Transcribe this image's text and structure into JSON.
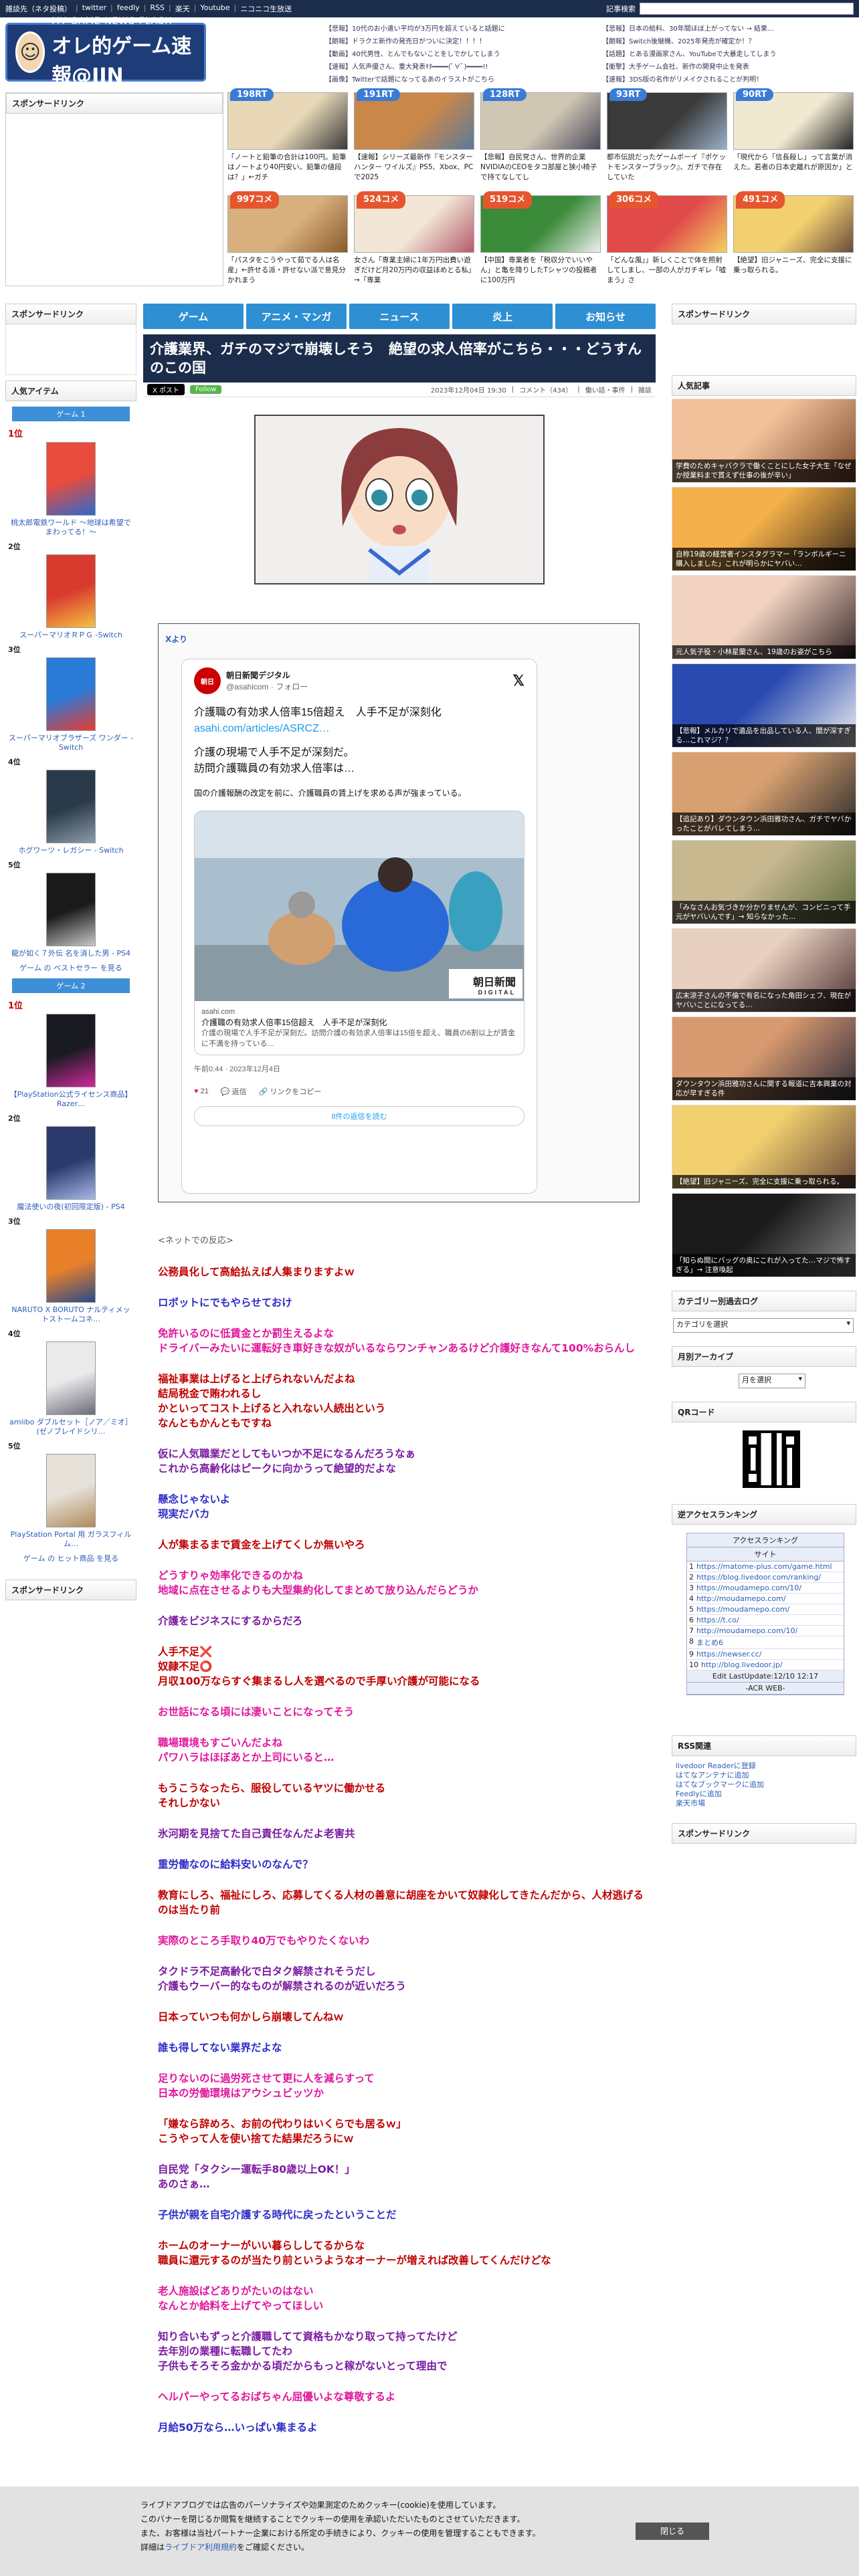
{
  "topbar": {
    "links": [
      "雑談先（ネタ投稿）",
      "twitter",
      "feedly",
      "RSS",
      "楽天",
      "Youtube",
      "ニコニコ生放送"
    ],
    "search_label": "記事検索",
    "search_placeholder": ""
  },
  "logo": {
    "sub": "MY GAME NEWS FLASH",
    "main": "オレ的ゲーム速報@JIN"
  },
  "head_links_left": [
    "【悲報】10代のお小遣い平均が3万円を超えていると話題に",
    "【朗報】ドラクエ新作の発売日がついに決定！！！！",
    "【動画】40代男性、とんでもないことをしでかしてしまう",
    "【速報】人気声優さん、重大発表ｷﾀ━━━━(ﾟ∀ﾟ)━━━━!!",
    "【画像】Twitterで話題になってるあのイラストがこちら"
  ],
  "head_links_right": [
    "【悲報】日本の給料、30年間ほぼ上がってない → 結果…",
    "【朗報】Switch後継機、2025年発売が確定か！？",
    "【話題】とある漫画家さん、YouTubeで大暴走してしまう",
    "【衝撃】大手ゲーム会社、新作の開発中止を発表",
    "【速報】3DS版の名作がリメイクされることが判明！"
  ],
  "sponsor_label": "スポンサードリンク",
  "thumbs": [
    {
      "badge": "198RT",
      "kind": "rt",
      "cap": "「ノートと鉛筆の合計は100円。鉛筆はノートより40円安い。鉛筆の値段は？」←ガチ",
      "c1": "#e8d8b8",
      "c2": "#3a3a3a"
    },
    {
      "badge": "191RT",
      "kind": "rt",
      "cap": "【速報】シリーズ最新作『モンスターハンター ワイルズ』PS5、Xbox、PCで2025",
      "c1": "#c9874a",
      "c2": "#5a7a9a"
    },
    {
      "badge": "128RT",
      "kind": "rt",
      "cap": "【悲報】自民党さん、世界的企業NVIDIAのCEOをタコ部屋と狭小椅子で持てなしてし",
      "c1": "#d0c6b4",
      "c2": "#4a4a5a"
    },
    {
      "badge": "93RT",
      "kind": "rt",
      "cap": "都市伝説だったゲームボーイ『ポケットモンスタープラック』、ガチで存在していた",
      "c1": "#3a3a3a",
      "c2": "#9ab0c8"
    },
    {
      "badge": "90RT",
      "kind": "rt",
      "cap": "「現代から「信長殺し」って言葉が消えた。若者の日本史離れが原因か」と",
      "c1": "#f0e8d0",
      "c2": "#222222"
    },
    {
      "badge": "997コメ",
      "kind": "cm",
      "cap": "「パスタをこうやって茹でる人は名産」←許せる派・許せない派で意見分かれまう",
      "c1": "#d8b080",
      "c2": "#8a5a2a"
    },
    {
      "badge": "524コメ",
      "kind": "cm",
      "cap": "女さん「専業主婦に1年万円出費い遊ぎだけど月20万円の収益ほめとる私」→「専業",
      "c1": "#f2e6d6",
      "c2": "#b45a6a"
    },
    {
      "badge": "519コメ",
      "kind": "cm",
      "cap": "【中国】専業者を「税収分でいいやん」と亀を降りしたTシャツの投稿者に100万円",
      "c1": "#3a8a3a",
      "c2": "#eeeeee"
    },
    {
      "badge": "306コメ",
      "kind": "cm",
      "cap": "「どんな風」」新しくことで体を照射してしまし、一部の人がガチギレ「嘘まう」さ",
      "c1": "#e04a4a",
      "c2": "#f4d060"
    },
    {
      "badge": "491コメ",
      "kind": "cm",
      "cap": "【絶望】旧ジャニーズ、完全に支援に乗っ取られる。",
      "c1": "#f2d070",
      "c2": "#6a4a3a"
    }
  ],
  "nav": [
    "ゲーム",
    "アニメ・マンガ",
    "ニュース",
    "炎上",
    "お知らせ"
  ],
  "left_sidebar": {
    "sponsor": "スポンサードリンク",
    "popular": "人気アイテム",
    "tab1": "ゲーム 1",
    "tab2": "ゲーム 2",
    "more1": "ゲーム の ベストセラー を見る",
    "more2": "ゲーム の ヒット商品 を見る",
    "sponsor2": "スポンサードリンク",
    "group1": [
      {
        "no": "1位",
        "name": "桃太郎電鉄ワールド ～地球は希望でまわってる！～",
        "c1": "#e94b3c",
        "c2": "#2a6ad0"
      },
      {
        "no": "2位",
        "name": "スーパーマリオＲＰＧ -Switch",
        "c1": "#d93a2e",
        "c2": "#f5c242"
      },
      {
        "no": "3位",
        "name": "スーパーマリオブラザーズ ワンダー -Switch",
        "c1": "#2a7ad8",
        "c2": "#e83a2e"
      },
      {
        "no": "4位",
        "name": "ホグワーツ・レガシー - Switch",
        "c1": "#2a3a4a",
        "c2": "#8a9aa8"
      },
      {
        "no": "5位",
        "name": "龍が如く７外伝 名を消した男 - PS4",
        "c1": "#1a1a1a",
        "c2": "#c8c8c8"
      }
    ],
    "group2": [
      {
        "no": "1位",
        "name": "【PlayStation公式ライセンス商品】Razer…",
        "c1": "#1a1a22",
        "c2": "#d02a9a"
      },
      {
        "no": "2位",
        "name": "魔法使いの夜(初回限定版) - PS4",
        "c1": "#2a3a6a",
        "c2": "#a8b8e8"
      },
      {
        "no": "3位",
        "name": "NARUTO X BORUTO ナルティメットストームコネ…",
        "c1": "#e8802a",
        "c2": "#2a4a8a"
      },
      {
        "no": "4位",
        "name": "amiibo ダブルセット［ノア／ミオ］(ゼノブレイドシリ…",
        "c1": "#eaeaea",
        "c2": "#6a6a7a"
      },
      {
        "no": "5位",
        "name": "PlayStation Portal 用 ガラスフィルム…",
        "c1": "#e6e2da",
        "c2": "#b08a5a"
      }
    ]
  },
  "article": {
    "title": "介護業界、ガチのマジで崩壊しそう　絶望の求人倍率がこちら・・・どうすんのこの国",
    "x_post": "X ポスト",
    "follow": "Follow",
    "date": "2023年12月04日 19:30",
    "comments": "コメント（434）",
    "category": "働い話・事件",
    "misc": "雑談",
    "embed_source": "Xより",
    "tweet": {
      "name": "朝日新聞デジタル",
      "handle": "@asahicom · フォロー",
      "avatar_text": "朝日",
      "line1": "介護職の有効求人倍率15倍超え　人手不足が深刻化",
      "link": "asahi.com/articles/ASRCZ…",
      "line2": "介護の現場で人手不足が深刻だ。",
      "line3": "訪問介護職員の有効求人倍率は…",
      "line4": "国の介護報酬の改定を前に、介護職員の賃上げを求める声が強まっている。",
      "card_domain": "asahi.com",
      "card_title": "介護職の有効求人倍率15倍超え　人手不足が深刻化",
      "card_desc": "介護の現場で人手不足が深刻だ。訪問介護の有効求人倍率は15倍を超え、職員の6割以上が賃金に不満を持っている…",
      "card_logo1": "朝日新聞",
      "card_logo2": "DIGITAL",
      "time": "午前0:44 · 2023年12月4日",
      "likes": "21",
      "reply": "返信",
      "copy": "リンクをコピー",
      "read": "8件の返信を読む"
    },
    "comments_head": "<ネットでの反応>",
    "comment_list": [
      {
        "t": "公務員化して高給払えば人集まりますよｗ",
        "c": "#c00000"
      },
      {
        "t": "ロボットにでもやらせておけ",
        "c": "#2d2dc8"
      },
      {
        "t": "免許いるのに低賃金とか罰生えるよな\nドライバーみたいに運転好き車好きな奴がいるならワンチャンあるけど介護好きなんて100%おらんし",
        "c": "#e0169c"
      },
      {
        "t": "福祉事業は上げると上げられないんだよね\n結局税金で賄われるし\nかといってコスト上げると入れない人続出という\nなんともかんともですね",
        "c": "#c00000"
      },
      {
        "t": "仮に人気職業だとしてもいつか不足になるんだろうなぁ\nこれから高齢化はピークに向かうって絶望的だよな",
        "c": "#7a1aa0"
      },
      {
        "t": "懸念じゃないよ\n現実だバカ",
        "c": "#2d2dc8"
      },
      {
        "t": "人が集まるまで賃金を上げてくしか無いやろ",
        "c": "#c00000"
      },
      {
        "t": "どうすりゃ効率化できるのかね\n地域に点在させるよりも大型集約化してまとめて放り込んだらどうか",
        "c": "#e0169c"
      },
      {
        "t": "介護をビジネスにするからだろ",
        "c": "#7a1aa0"
      },
      {
        "t": "人手不足❌\n奴隷不足⭕\n月収100万ならすぐ集まるし人を選べるので手厚い介護が可能になる",
        "c": "#c00000"
      },
      {
        "t": "お世話になる頃には凄いことになってそう",
        "c": "#e0169c"
      },
      {
        "t": "職場環境もすごいんだよね\nパワハラはほぼあとか上司にいると…",
        "c": "#e0169c"
      },
      {
        "t": "もうこうなったら、服役しているヤツに働かせる\nそれしかない",
        "c": "#c00000"
      },
      {
        "t": "氷河期を見捨てた自己責任なんだよ老害共",
        "c": "#7a1aa0"
      },
      {
        "t": "重労働なのに給料安いのなんで？",
        "c": "#2d2dc8"
      },
      {
        "t": "教育にしろ、福祉にしろ、応募してくる人材の善意に胡座をかいて奴隷化してきたんだから、人材逃げるのは当たり前",
        "c": "#c00000"
      },
      {
        "t": "実際のところ手取り40万でもやりたくないわ",
        "c": "#e0169c"
      },
      {
        "t": "タクドラ不足高齢化で白タク解禁されそうだし\n介護もウーバー的なものが解禁されるのが近いだろう",
        "c": "#7a1aa0"
      },
      {
        "t": "日本っていつも何かしら崩壊してんねｗ",
        "c": "#c00000"
      },
      {
        "t": "誰も得してない業界だよな",
        "c": "#2d2dc8"
      },
      {
        "t": "足りないのに過労死させて更に人を減らすって\n日本の労働環境はアウシュビッツか",
        "c": "#e0169c"
      },
      {
        "t": "「嫌なら辞めろ、お前の代わりはいくらでも居るｗ」\nこうやって人を使い捨てた結果だろうにｗ",
        "c": "#c00000"
      },
      {
        "t": "自民党「タクシー運転手80歳以上OK！」\nあのさぁ…",
        "c": "#7a1aa0"
      },
      {
        "t": "子供が親を自宅介護する時代に戻ったということだ",
        "c": "#2d2dc8"
      },
      {
        "t": "ホームのオーナーがいい暮らししてるからな\n職員に還元するのが当たり前というようなオーナーが増えれば改善してくんだけどな",
        "c": "#c00000"
      },
      {
        "t": "老人施設ばどありがたいのはない\nなんとか給料を上げてやってほしい",
        "c": "#e0169c"
      },
      {
        "t": "知り合いもずっと介護職してて資格もかなり取って持ってたけど\n去年別の業種に転職してたわ\n子供もそろそろ金かかる頃だからもっと稼がないとって理由で",
        "c": "#7a1aa0"
      },
      {
        "t": "ヘルパーやってるおばちゃん屈優いよな尊敬するよ",
        "c": "#e0169c"
      },
      {
        "t": "月給50万なら…いっぱい集まるよ",
        "c": "#2d2dc8"
      }
    ]
  },
  "right_sidebar": {
    "sponsor": "スポンサードリンク",
    "popular": "人気記事",
    "pop_items": [
      {
        "cap": "学費のためキャバクラで働くことにした女子大生「なぜか授業料まで貰えず仕事の後が辛い」",
        "c1": "#f2c09a",
        "c2": "#7a4a2a"
      },
      {
        "cap": "自称19歳の経営者インスタグラマー「ランボルギーニ購入しました」これが明らかにヤバい…",
        "c1": "#f4b04a",
        "c2": "#3a2a1a"
      },
      {
        "cap": "元人気子役・小林星蘭さん、19歳のお姿がこちら",
        "c1": "#f2d2c0",
        "c2": "#3a2a2a"
      },
      {
        "cap": "【悲報】メルカリで遺品を出品している人、闇が深すぎる…これマジ？？",
        "c1": "#2a4ab0",
        "c2": "#f0f0f0"
      },
      {
        "cap": "【追記あり】ダウンタウン浜田雅功さん、ガチでヤバかったことがバレてしまう…",
        "c1": "#d8a070",
        "c2": "#2a2a2a"
      },
      {
        "cap": "「みなさんお気づきか分かりませんが、コンビニって手元がヤバいんです」→ 知らなかった…",
        "c1": "#c8b890",
        "c2": "#5a6a3a"
      },
      {
        "cap": "広末涼子さんの不倫で有名になった角田シェフ、現在がヤバいことになってる…",
        "c1": "#e8d0c0",
        "c2": "#4a3030"
      },
      {
        "cap": "ダウンタウン浜田雅功さんに関する報道に吉本興業の対応が早すぎる件",
        "c1": "#d89a70",
        "c2": "#2a2a3a"
      },
      {
        "cap": "【絶望】旧ジャニーズ、完全に支援に乗っ取られる。",
        "c1": "#f2d070",
        "c2": "#6a4a3a"
      },
      {
        "cap": "「知らぬ間にバッグの奥にこれが入ってた…マジで怖すぎる」→ 注意喚起",
        "c1": "#1a1a1a",
        "c2": "#8a8a8a"
      }
    ],
    "cat_head": "カテゴリー別過去ログ",
    "cat_select": "カテゴリを選択",
    "month_head": "月別アーカイブ",
    "month_select": "月を選択",
    "qr_head": "QRコード",
    "rank_head": "逆アクセスランキング",
    "rank_title": "アクセスランキング",
    "rank_col": "サイト",
    "rank_rows": [
      {
        "n": "1",
        "u": "https://matome-plus.com/game.html"
      },
      {
        "n": "2",
        "u": "https://blog.livedoor.com/ranking/"
      },
      {
        "n": "3",
        "u": "https://moudamepo.com/10/"
      },
      {
        "n": "4",
        "u": "http://moudamepo.com/"
      },
      {
        "n": "5",
        "u": "https://moudamepo.com/"
      },
      {
        "n": "6",
        "u": "https://t.co/"
      },
      {
        "n": "7",
        "u": "http://moudamepo.com/10/"
      },
      {
        "n": "8",
        "u": "まとめ6"
      },
      {
        "n": "9",
        "u": "https://newser.cc/"
      },
      {
        "n": "10",
        "u": "http://blog.livedoor.jp/"
      }
    ],
    "rank_foot": "Edit LastUpdate:12/10 12:17",
    "rank_foot2": "-ACR WEB-",
    "rss_head": "RSS関連",
    "rss_links": [
      "livedoor Readerに登録",
      "はてなアンテナに追加",
      "はてなブックマークに追加",
      "Feedlyに追加",
      "楽天市場"
    ],
    "sponsor2": "スポンサードリンク"
  },
  "cookie": {
    "line1": "ライブドアブログでは広告のパーソナライズや効果測定のためクッキー(cookie)を使用しています。",
    "line2": "このバナーを閉じるか閲覧を継続することでクッキーの使用を承認いただいたものとさせていただきます。",
    "line3": "また、お客様は当社パートナー企業における所定の手続きにより、クッキーの使用を管理することもできます。",
    "line4a": "詳細は",
    "line4b": "ライブドア利用規約",
    "line4c": "をご確認ください。",
    "close": "閉じる"
  }
}
